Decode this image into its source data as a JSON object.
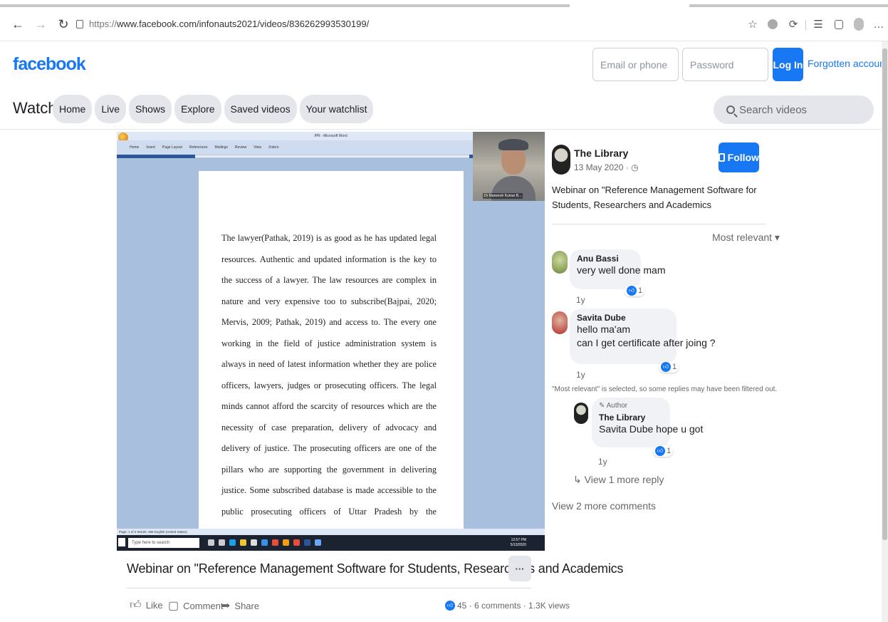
{
  "browser": {
    "url_prefix": "https://",
    "url_rest": "www.facebook.com/infonauts2021/videos/836262993530199/"
  },
  "header": {
    "logo": "facebook",
    "email_placeholder": "Email or phone",
    "password_placeholder": "Password",
    "login_label": "Log In",
    "forgot_label": "Forgotten account?"
  },
  "watch": {
    "title": "Watch",
    "tabs": [
      "Home",
      "Live",
      "Shows",
      "Explore",
      "Saved videos",
      "Your watchlist"
    ],
    "search_placeholder": "Search videos"
  },
  "video_frame": {
    "word_title": "IPR - Microsoft Word",
    "ribbon_tabs": [
      "Home",
      "Insert",
      "Page Layout",
      "References",
      "Mailings",
      "Review",
      "View",
      "Zotero"
    ],
    "webcam_name": "Dr Maneesh Kumar B...",
    "doc_text": "The lawyer(Pathak, 2019) is as good as he has updated legal resources. Authentic and updated information is the key to the success of a lawyer. The law resources are complex in nature and very expensive too to subscribe(Bajpai, 2020; Mervis, 2009; Pathak, 2019) and access to. The every one working in the field of justice administration system is always in need of latest information whether they are police officers, lawyers, judges or prosecuting officers. The legal minds cannot afford the scarcity of resources which are the necessity of case preparation, delivery of advocacy and delivery of justice. The prosecuting officers are one of the pillars who are supporting the government in delivering justice. Some subscribed database is made accessible to the public prosecuting officers of Uttar Pradesh by the Prosecution Department of the Uttar Pradesh as the central nodal agency. But, the challenge is to continue the",
    "status_text": "Page: 1 of 2   Words: 396   English (United States)",
    "taskbar_search": "Type here to search",
    "clock_time": "12:57 PM",
    "clock_date": "5/13/2020",
    "clock_lang": "ENG US"
  },
  "post": {
    "title": "Webinar on \"Reference Management Software for Students, Researchers and Academics",
    "more_label": "···",
    "like_label": "Like",
    "comment_label": "Comment",
    "share_label": "Share",
    "stats": "45 · 6 comments · 1.3K views"
  },
  "sidebar": {
    "page_name": "The Library",
    "date": "13 May 2020 ·",
    "follow_label": "Follow",
    "description": "Webinar on \"Reference Management Software for Students, Researchers and Academics",
    "sort_label": "Most relevant ▾",
    "comments": [
      {
        "name": "Anu Bassi",
        "lines": [
          "very well done mam"
        ],
        "reactions": "1",
        "time": "1y"
      },
      {
        "name": "Savita Dube",
        "lines": [
          "hello ma'am",
          "can I get certificate after joing ?"
        ],
        "reactions": "1",
        "time": "1y"
      }
    ],
    "filter_note": "\"Most relevant\" is selected, so some replies may have been filtered out.",
    "reply": {
      "tag": "Author",
      "name": "The Library",
      "text": "Savita Dube hope u got",
      "reactions": "1",
      "time": "1y"
    },
    "view_replies": "View 1 more reply",
    "view_comments": "View 2 more comments"
  }
}
